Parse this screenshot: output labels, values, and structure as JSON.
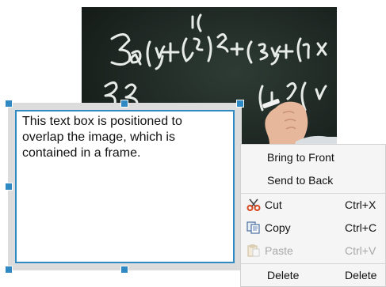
{
  "text_box": {
    "content": "This text box is positioned to overlap the image, which is contained in a frame."
  },
  "context_menu": {
    "bring_to_front": "Bring to Front",
    "send_to_back": "Send to Back",
    "cut": {
      "label": "Cut",
      "shortcut": "Ctrl+X",
      "icon": "scissors-icon"
    },
    "copy": {
      "label": "Copy",
      "shortcut": "Ctrl+C",
      "icon": "copy-icon"
    },
    "paste": {
      "label": "Paste",
      "shortcut": "Ctrl+V",
      "icon": "paste-icon",
      "disabled": true
    },
    "delete": {
      "label": "Delete",
      "shortcut": "Delete"
    }
  },
  "colors": {
    "selection": "#2f8ac4",
    "frame": "#dcdcdc",
    "menu_bg": "#f5f5f5"
  }
}
